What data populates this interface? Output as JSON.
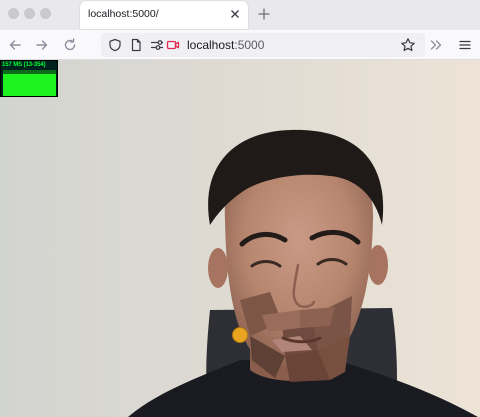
{
  "tab": {
    "title": "localhost:5000/"
  },
  "urlbar": {
    "host": "localhost",
    "port": ":5000"
  },
  "stats": {
    "label": "157 MS (13-354)"
  }
}
